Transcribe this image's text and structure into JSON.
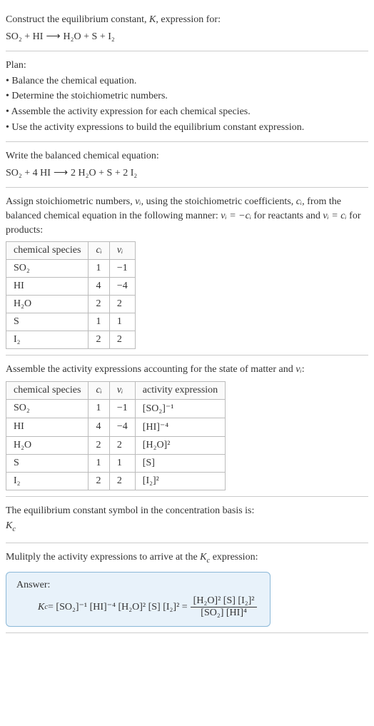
{
  "intro": {
    "title_prefix": "Construct the equilibrium constant, ",
    "title_k": "K",
    "title_suffix": ", expression for:",
    "eq_left": "SO₂ + HI",
    "eq_arrow": "⟶",
    "eq_right": "H₂O + S + I₂"
  },
  "plan": {
    "title": "Plan:",
    "items": [
      "• Balance the chemical equation.",
      "• Determine the stoichiometric numbers.",
      "• Assemble the activity expression for each chemical species.",
      "• Use the activity expressions to build the equilibrium constant expression."
    ]
  },
  "balanced": {
    "title": "Write the balanced chemical equation:",
    "eq_left": "SO₂ + 4 HI",
    "eq_arrow": "⟶",
    "eq_right": "2 H₂O + S + 2 I₂"
  },
  "stoich": {
    "intro_a": "Assign stoichiometric numbers, ",
    "nu": "νᵢ",
    "intro_b": ", using the stoichiometric coefficients, ",
    "ci": "cᵢ",
    "intro_c": ", from the balanced chemical equation in the following manner: ",
    "rel1": "νᵢ = −cᵢ",
    "intro_d": " for reactants and ",
    "rel2": "νᵢ = cᵢ",
    "intro_e": " for products:",
    "headers": [
      "chemical species",
      "cᵢ",
      "νᵢ"
    ],
    "rows": [
      {
        "sp": "SO₂",
        "c": "1",
        "v": "−1"
      },
      {
        "sp": "HI",
        "c": "4",
        "v": "−4"
      },
      {
        "sp": "H₂O",
        "c": "2",
        "v": "2"
      },
      {
        "sp": "S",
        "c": "1",
        "v": "1"
      },
      {
        "sp": "I₂",
        "c": "2",
        "v": "2"
      }
    ]
  },
  "activity": {
    "intro_a": "Assemble the activity expressions accounting for the state of matter and ",
    "nu": "νᵢ",
    "intro_b": ":",
    "headers": [
      "chemical species",
      "cᵢ",
      "νᵢ",
      "activity expression"
    ],
    "rows": [
      {
        "sp": "SO₂",
        "c": "1",
        "v": "−1",
        "act": "[SO₂]⁻¹"
      },
      {
        "sp": "HI",
        "c": "4",
        "v": "−4",
        "act": "[HI]⁻⁴"
      },
      {
        "sp": "H₂O",
        "c": "2",
        "v": "2",
        "act": "[H₂O]²"
      },
      {
        "sp": "S",
        "c": "1",
        "v": "1",
        "act": "[S]"
      },
      {
        "sp": "I₂",
        "c": "2",
        "v": "2",
        "act": "[I₂]²"
      }
    ]
  },
  "symbol": {
    "text": "The equilibrium constant symbol in the concentration basis is:",
    "kc": "K",
    "csub": "c"
  },
  "multiply": {
    "intro_a": "Mulitply the activity expressions to arrive at the ",
    "kc": "K",
    "csub": "c",
    "intro_b": " expression:"
  },
  "answer": {
    "label": "Answer:",
    "kc": "K",
    "csub": "c",
    "eq": " = [SO₂]⁻¹ [HI]⁻⁴ [H₂O]² [S] [I₂]² = ",
    "num": "[H₂O]² [S] [I₂]²",
    "den": "[SO₂] [HI]⁴"
  },
  "chart_data": {
    "type": "table",
    "tables": [
      {
        "title": "Stoichiometric numbers",
        "headers": [
          "chemical species",
          "c_i",
          "ν_i"
        ],
        "rows": [
          [
            "SO2",
            1,
            -1
          ],
          [
            "HI",
            4,
            -4
          ],
          [
            "H2O",
            2,
            2
          ],
          [
            "S",
            1,
            1
          ],
          [
            "I2",
            2,
            2
          ]
        ]
      },
      {
        "title": "Activity expressions",
        "headers": [
          "chemical species",
          "c_i",
          "ν_i",
          "activity expression"
        ],
        "rows": [
          [
            "SO2",
            1,
            -1,
            "[SO2]^-1"
          ],
          [
            "HI",
            4,
            -4,
            "[HI]^-4"
          ],
          [
            "H2O",
            2,
            2,
            "[H2O]^2"
          ],
          [
            "S",
            1,
            1,
            "[S]"
          ],
          [
            "I2",
            2,
            2,
            "[I2]^2"
          ]
        ]
      }
    ]
  }
}
